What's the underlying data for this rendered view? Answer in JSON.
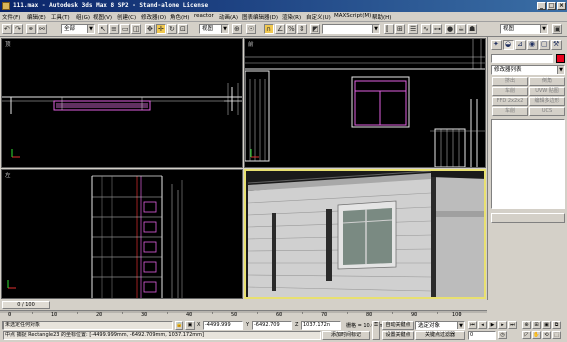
{
  "title": "111.max - Autodesk 3ds Max 8 SP2  - Stand-alone License",
  "window_buttons": {
    "min": "_",
    "max": "□",
    "close": "×"
  },
  "menu": [
    "文件(F)",
    "编辑(E)",
    "工具(T)",
    "组(G)",
    "视图(V)",
    "创建(C)",
    "修改器(O)",
    "角色(H)",
    "reactor",
    "动画(A)",
    "图表编辑器(D)",
    "渲染(R)",
    "自定义(U)",
    "MAXScript(M)",
    "帮助(H)"
  ],
  "toolbar": {
    "selection_filter": "全部",
    "ref_coord": "视图",
    "named_selection": "视图"
  },
  "viewports": {
    "top": {
      "label": "顶"
    },
    "front": {
      "label": "前"
    },
    "left": {
      "label": "左"
    },
    "persp": {
      "label": ""
    }
  },
  "command_panel": {
    "object_name": "",
    "modifier_list": "修改器列表",
    "buttons": [
      "挤出",
      "倒角",
      "车削",
      "UVW 贴图",
      "FFD 2x2x2",
      "编辑多边形",
      "车削",
      "UCS"
    ],
    "swatch_color": "#e8001c"
  },
  "timeline": {
    "frame_display": "0 / 100"
  },
  "ruler_ticks": [
    "0",
    "10",
    "20",
    "30",
    "40",
    "50",
    "60",
    "70",
    "80",
    "90",
    "100"
  ],
  "status": {
    "selection_info": "未选定任何对象",
    "prompt": "中点  捕捉 Rectangle23 的坐标位置: [-4499.999mm, -6492.709mm, 1037.172mm]",
    "x_label": "X",
    "x_value": "-4499.999",
    "y_label": "Y",
    "y_value": "-6492.709",
    "z_label": "Z",
    "z_value": "1037.172n",
    "grid": "栅格 = 10.0mm",
    "add_time_tag": "添加时间标记",
    "auto_key": "自动关键点",
    "set_key": "设置关键点",
    "key_mode": "选定对象",
    "key_filters": "关键点过滤器",
    "frame": "0"
  }
}
